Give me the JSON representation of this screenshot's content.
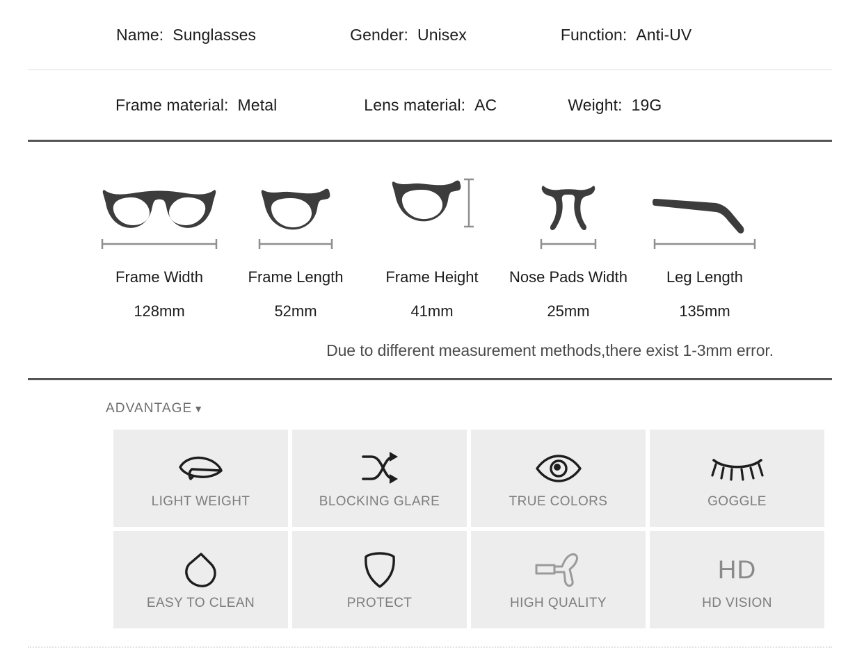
{
  "specs": {
    "row1": [
      {
        "label": "Name:",
        "value": "Sunglasses"
      },
      {
        "label": "Gender:",
        "value": "Unisex"
      },
      {
        "label": "Function:",
        "value": "Anti-UV"
      }
    ],
    "row2": [
      {
        "label": "Frame material:",
        "value": "Metal"
      },
      {
        "label": "Lens material:",
        "value": "AC"
      },
      {
        "label": "Weight:",
        "value": "19G"
      }
    ]
  },
  "measurements": {
    "items": [
      {
        "icon": "glasses-front-icon",
        "label": "Frame Width",
        "value": "128mm"
      },
      {
        "icon": "single-lens-icon",
        "label": "Frame Length",
        "value": "52mm"
      },
      {
        "icon": "lens-height-icon",
        "label": "Frame Height",
        "value": "41mm"
      },
      {
        "icon": "nose-pads-icon",
        "label": "Nose Pads Width",
        "value": "25mm"
      },
      {
        "icon": "temple-arm-icon",
        "label": "Leg Length",
        "value": "135mm"
      }
    ],
    "note": "Due to different measurement methods,there exist 1-3mm error."
  },
  "advantage": {
    "title": "ADVANTAGE",
    "caret": "▼",
    "tiles": [
      {
        "icon": "leaf-icon",
        "label": "LIGHT WEIGHT"
      },
      {
        "icon": "shuffle-arrows-icon",
        "label": "BLOCKING GLARE"
      },
      {
        "icon": "eye-open-icon",
        "label": "TRUE COLORS"
      },
      {
        "icon": "eye-closed-lashes-icon",
        "label": "GOGGLE"
      },
      {
        "icon": "water-droplet-icon",
        "label": "EASY TO CLEAN"
      },
      {
        "icon": "shield-icon",
        "label": "PROTECT"
      },
      {
        "icon": "hammer-icon",
        "label": "HIGH QUALITY"
      },
      {
        "icon": "hd-text-icon",
        "label": "HD VISION",
        "glyph": "HD"
      }
    ]
  },
  "colors": {
    "art": "#3c3c3c",
    "rule": "#8f8f8f",
    "tile_bg": "#ededed",
    "tile_text": "#7d7d7d",
    "divider_dark": "#555555",
    "divider_light": "#dedede"
  }
}
